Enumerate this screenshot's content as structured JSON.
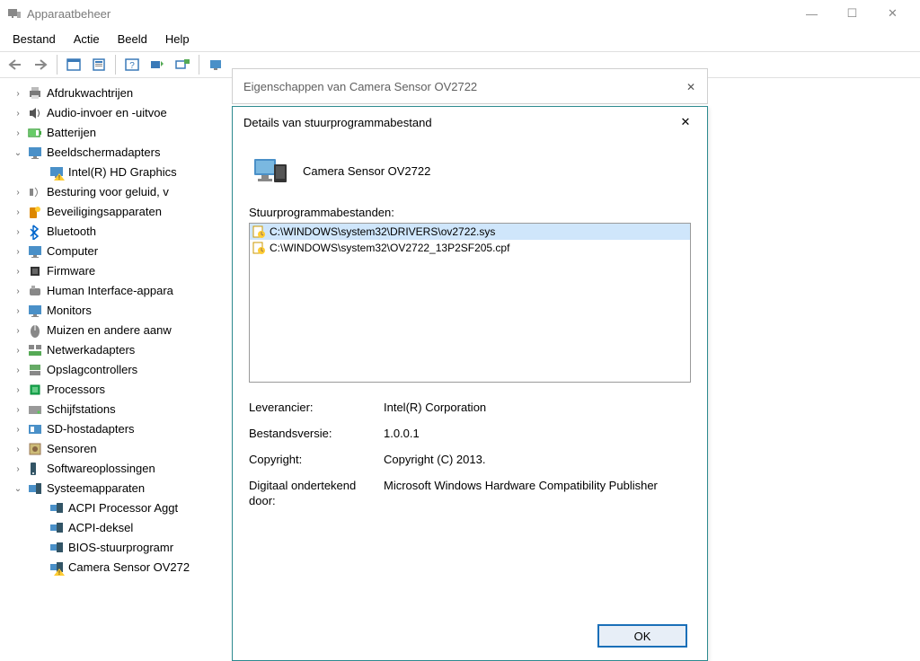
{
  "window": {
    "title": "Apparaatbeheer",
    "minimize_glyph": "—",
    "maximize_glyph": "☐",
    "close_glyph": "✕"
  },
  "menubar": {
    "items": [
      "Bestand",
      "Actie",
      "Beeld",
      "Help"
    ]
  },
  "tree": [
    {
      "label": "Afdrukwachtrijen",
      "icon": "printer",
      "arrow": ">",
      "indent": 0
    },
    {
      "label": "Audio-invoer en -uitvoe",
      "icon": "speaker",
      "arrow": ">",
      "indent": 0
    },
    {
      "label": "Batterijen",
      "icon": "battery",
      "arrow": ">",
      "indent": 0
    },
    {
      "label": "Beeldschermadapters",
      "icon": "display",
      "arrow": "v",
      "indent": 0
    },
    {
      "label": "Intel(R) HD Graphics",
      "icon": "display-warn",
      "arrow": "",
      "indent": 1
    },
    {
      "label": "Besturing voor geluid, v",
      "icon": "sound",
      "arrow": ">",
      "indent": 0
    },
    {
      "label": "Beveiligingsapparaten",
      "icon": "security",
      "arrow": ">",
      "indent": 0
    },
    {
      "label": "Bluetooth",
      "icon": "bluetooth",
      "arrow": ">",
      "indent": 0
    },
    {
      "label": "Computer",
      "icon": "monitor",
      "arrow": ">",
      "indent": 0
    },
    {
      "label": "Firmware",
      "icon": "chip",
      "arrow": ">",
      "indent": 0
    },
    {
      "label": "Human Interface-appara",
      "icon": "hid",
      "arrow": ">",
      "indent": 0
    },
    {
      "label": "Monitors",
      "icon": "monitor",
      "arrow": ">",
      "indent": 0
    },
    {
      "label": "Muizen en andere aanw",
      "icon": "mouse",
      "arrow": ">",
      "indent": 0
    },
    {
      "label": "Netwerkadapters",
      "icon": "network",
      "arrow": ">",
      "indent": 0
    },
    {
      "label": "Opslagcontrollers",
      "icon": "storage",
      "arrow": ">",
      "indent": 0
    },
    {
      "label": "Processors",
      "icon": "cpu",
      "arrow": ">",
      "indent": 0
    },
    {
      "label": "Schijfstations",
      "icon": "disk",
      "arrow": ">",
      "indent": 0
    },
    {
      "label": "SD-hostadapters",
      "icon": "sd",
      "arrow": ">",
      "indent": 0
    },
    {
      "label": "Sensoren",
      "icon": "sensor",
      "arrow": ">",
      "indent": 0
    },
    {
      "label": "Softwareoplossingen",
      "icon": "software",
      "arrow": ">",
      "indent": 0
    },
    {
      "label": "Systeemapparaten",
      "icon": "system",
      "arrow": "v",
      "indent": 0
    },
    {
      "label": "ACPI Processor Aggt",
      "icon": "sysdev",
      "arrow": "",
      "indent": 1
    },
    {
      "label": "ACPI-deksel",
      "icon": "sysdev",
      "arrow": "",
      "indent": 1
    },
    {
      "label": "BIOS-stuurprogramr",
      "icon": "sysdev",
      "arrow": "",
      "indent": 1
    },
    {
      "label": "Camera Sensor OV272",
      "icon": "sysdev-warn",
      "arrow": "",
      "indent": 1
    }
  ],
  "dialog1": {
    "title": "Eigenschappen van Camera Sensor OV2722",
    "close_glyph": "✕"
  },
  "dialog2": {
    "title": "Details van stuurprogrammabestand",
    "close_glyph": "✕",
    "device_name": "Camera Sensor OV2722",
    "list_label": "Stuurprogrammabestanden:",
    "files": [
      {
        "path": "C:\\WINDOWS\\system32\\DRIVERS\\ov2722.sys",
        "selected": true
      },
      {
        "path": "C:\\WINDOWS\\system32\\OV2722_13P2SF205.cpf",
        "selected": false
      }
    ],
    "info": {
      "vendor_label": "Leverancier:",
      "vendor_value": "Intel(R) Corporation",
      "version_label": "Bestandsversie:",
      "version_value": "1.0.0.1",
      "copyright_label": "Copyright:",
      "copyright_value": "Copyright (C) 2013.",
      "signer_label": "Digitaal ondertekend door:",
      "signer_value": "Microsoft Windows Hardware Compatibility Publisher"
    },
    "ok_label": "OK"
  }
}
